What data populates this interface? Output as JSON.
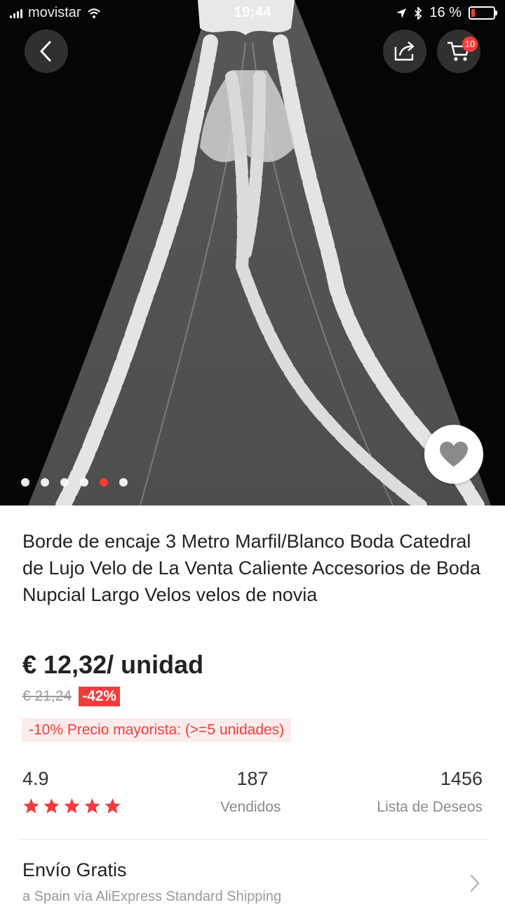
{
  "status_bar": {
    "carrier": "movistar",
    "time": "19:44",
    "battery": "16 %"
  },
  "header": {
    "cart_count": "10",
    "icons": [
      "back-arrow-icon",
      "share-icon",
      "cart-icon",
      "heart-icon"
    ]
  },
  "gallery": {
    "image_count": 6,
    "active_index": 4
  },
  "product": {
    "title": "Borde de encaje 3 Metro Marfil/Blanco Boda Catedral de Lujo Velo de La Venta Caliente Accesorios de Boda Nupcial Largo Velos velos de novia",
    "price": "€ 12,32/ unidad",
    "old_price": "€ 21,24",
    "discount": "-42%",
    "wholesale": "-10% Precio mayorista: (>=5 unidades)"
  },
  "stats": {
    "rating": "4.9",
    "rating_stars": 5,
    "sold_count": "187",
    "sold_label": "Vendidos",
    "wishlist_count": "1456",
    "wishlist_label": "Lista de Deseos"
  },
  "shipping": {
    "title": "Envío Gratis",
    "subtitle": "a Spain vía AliExpress Standard Shipping"
  },
  "colors": {
    "accent": "#f23c3c",
    "hero_bg": "#050505"
  }
}
